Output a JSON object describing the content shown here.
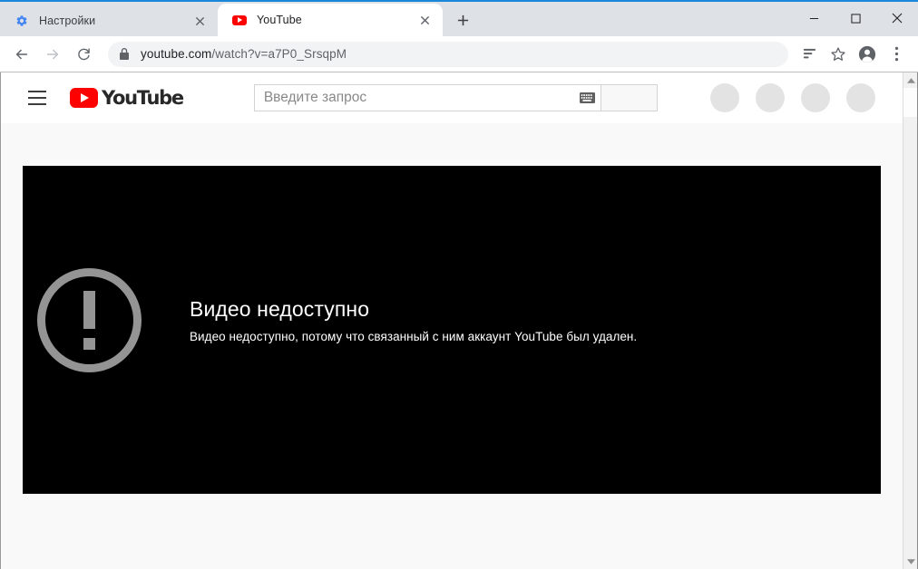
{
  "browser": {
    "tabs": [
      {
        "title": "Настройки",
        "favicon": "gear-icon",
        "active": false,
        "close_label": "×"
      },
      {
        "title": "YouTube",
        "favicon": "youtube-icon",
        "active": true,
        "close_label": "×"
      }
    ],
    "new_tab_label": "+",
    "window_controls": {
      "minimize": "—",
      "maximize": "▢",
      "close": "✕"
    },
    "navigation": {
      "back": "back-arrow-icon",
      "forward": "forward-arrow-icon",
      "reload": "reload-icon"
    },
    "address_bar": {
      "lock": "lock-icon",
      "host": "youtube.com",
      "path": "/watch?v=a7P0_SrsqpM",
      "full_url": "youtube.com/watch?v=a7P0_SrsqpM"
    },
    "toolbar_icons": [
      "reading-list-icon",
      "bookmark-star-icon",
      "profile-avatar-icon",
      "more-menu-icon"
    ],
    "accent_color": "#1a87d8",
    "tabstrip_color": "#dee1e6"
  },
  "youtube": {
    "menu_label": "guide-menu",
    "logo_text": "YouTube",
    "logo_color": "#ff0000",
    "search": {
      "placeholder": "Введите запрос",
      "value": "",
      "keyboard_icon": "keyboard-icon",
      "button_label": ""
    },
    "header_skeletons": 4
  },
  "player": {
    "background": "#000000",
    "icon": "alert-exclamation-icon",
    "icon_color": "#949494",
    "error_title": "Видео недоступно",
    "error_subtitle": "Видео недоступно, потому что связанный с ним аккаунт YouTube был удален."
  },
  "page": {
    "background": "#f9f9f9",
    "scrollbar": {
      "up_arrow": "▲",
      "down_arrow": "▼"
    }
  }
}
